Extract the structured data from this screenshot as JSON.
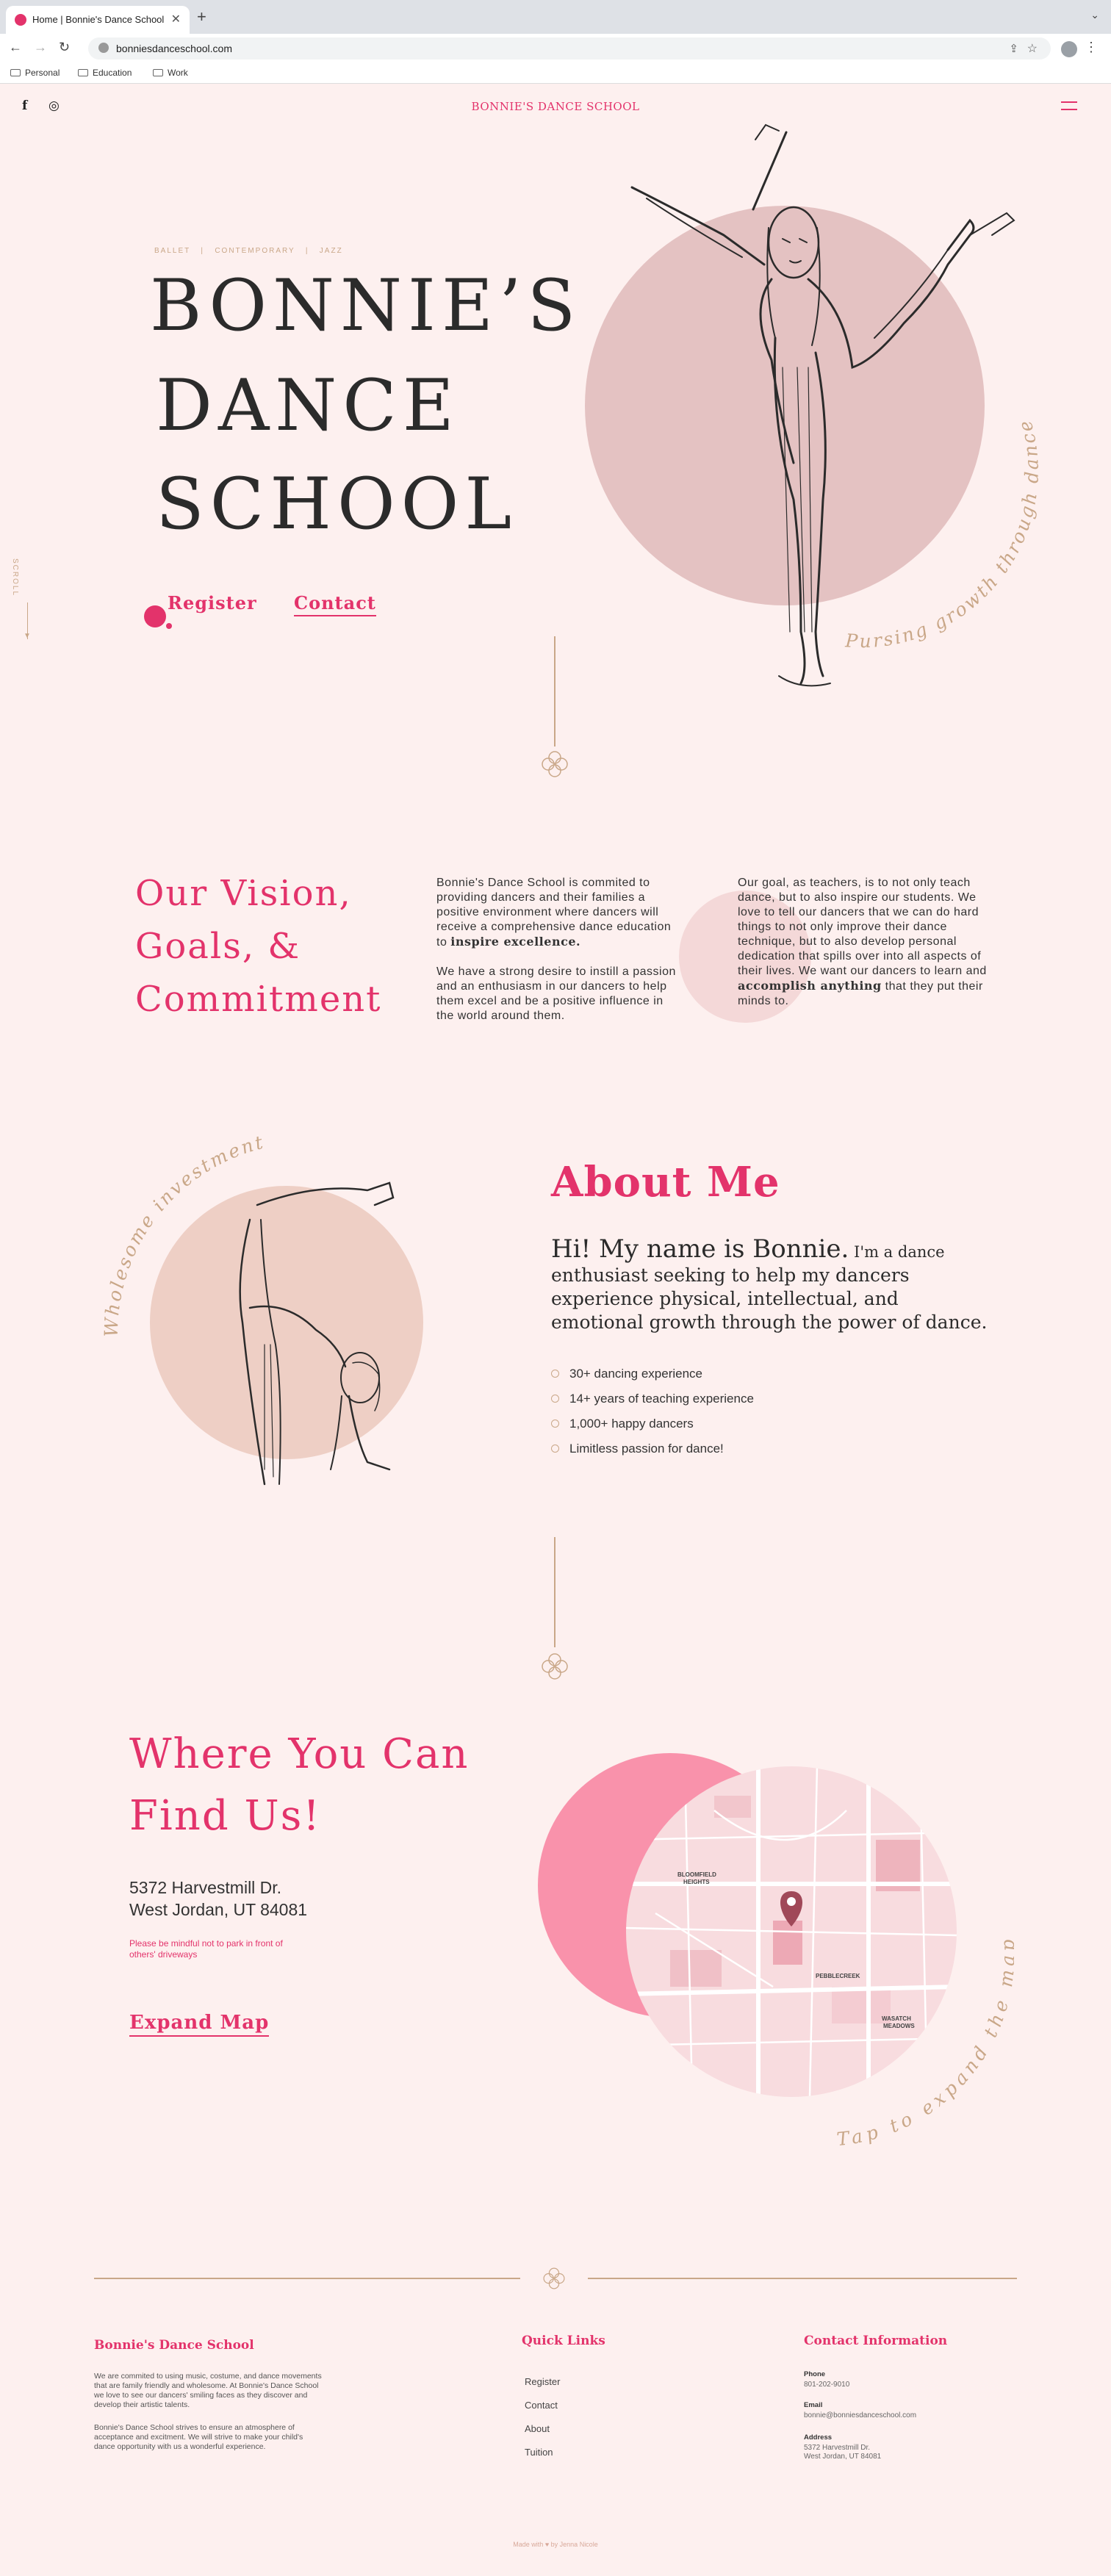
{
  "browser": {
    "tab_title": "Home | Bonnie's Dance School",
    "url": "bonniesdanceschool.com",
    "bookmarks": [
      "Personal",
      "Education",
      "Work"
    ]
  },
  "header": {
    "brand": "BONNIE'S DANCE SCHOOL",
    "social_facebook": "f",
    "social_instagram": "◎"
  },
  "hero": {
    "tags": "BALLET   |   CONTEMPORARY   |   JAZZ",
    "title_line1": "BONNIE’S",
    "title_line2": "DANCE",
    "title_line3": "SCHOOL",
    "register_label": "Register",
    "contact_label": "Contact",
    "scroll_label": "SCROLL",
    "circle_caption": "Pursing growth through dance"
  },
  "vision": {
    "heading_line1": "Our Vision,",
    "heading_line2": "Goals, &",
    "heading_line3": "Commitment",
    "col1_p1_pre": "Bonnie's Dance School is commited to providing dancers and their families a positive environment where dancers will receive a comprehensive dance education to ",
    "col1_p1_bold": "inspire excellence.",
    "col1_p2": "We have a strong desire to instill a passion and an enthusiasm in our dancers to help them excel and be a positive influence in the world around them.",
    "col2_pre": "Our goal, as teachers, is to not only teach dance, but to also inspire our students. We love to tell our dancers that we can do hard things to not only improve their dance technique, but to also develop personal dedication that spills over into all aspects of their lives. We want our dancers to learn and ",
    "col2_bold": "accomplish anything",
    "col2_post": " that they put their minds to."
  },
  "about": {
    "circle_caption": "Wholesome investment",
    "title": "About Me",
    "intro_big": "Hi! My name is Bonnie.",
    "intro_small": " I'm a dance",
    "intro_rest": "enthusiast seeking to help my dancers experience physical, intellectual, and emotional growth through the power of dance.",
    "bullets": [
      "30+ dancing experience",
      "14+ years of teaching experience",
      "1,000+ happy dancers",
      "Limitless passion for dance!"
    ]
  },
  "find": {
    "title_line1": "Where You Can",
    "title_line2": "Find Us!",
    "address_line1": "5372 Harvestmill Dr.",
    "address_line2": "West Jordan, UT 84081",
    "parking_note": "Please be mindful not to park in front of others' driveways",
    "expand_label": "Expand Map",
    "map_caption": "Tap to expand the map",
    "map_labels": {
      "l1": "BLOOMFIELD",
      "l2": "HEIGHTS",
      "l3": "PEBBLECREEK",
      "l4": "WASATCH",
      "l5": "MEADOWS"
    }
  },
  "footer": {
    "col1_title": "Bonnie's Dance School",
    "col1_p1": "We are commited to using music, costume, and dance movements that are family friendly and wholesome. At Bonnie's Dance School we love to see our dancers' smiling faces as they discover and develop their artistic talents.",
    "col1_p2": "Bonnie's Dance School strives to ensure an atmosphere of acceptance and excitment. We will strive to make your child's dance opportunity with us a wonderful experience.",
    "col2_title": "Quick Links",
    "links": [
      "Register",
      "Contact",
      "About",
      "Tuition"
    ],
    "col3_title": "Contact Information",
    "phone_label": "Phone",
    "phone": "801-202-9010",
    "email_label": "Email",
    "email": "bonnie@bonniesdanceschool.com",
    "address_label": "Address",
    "address_line1": "5372 Harvestmill Dr.",
    "address_line2": "West Jordan, UT 84081",
    "credit": "Made with ♥ by Jenna Nicole"
  },
  "colors": {
    "accent": "#e3336b",
    "gold": "#c9a788",
    "background": "#fdf0ef"
  }
}
